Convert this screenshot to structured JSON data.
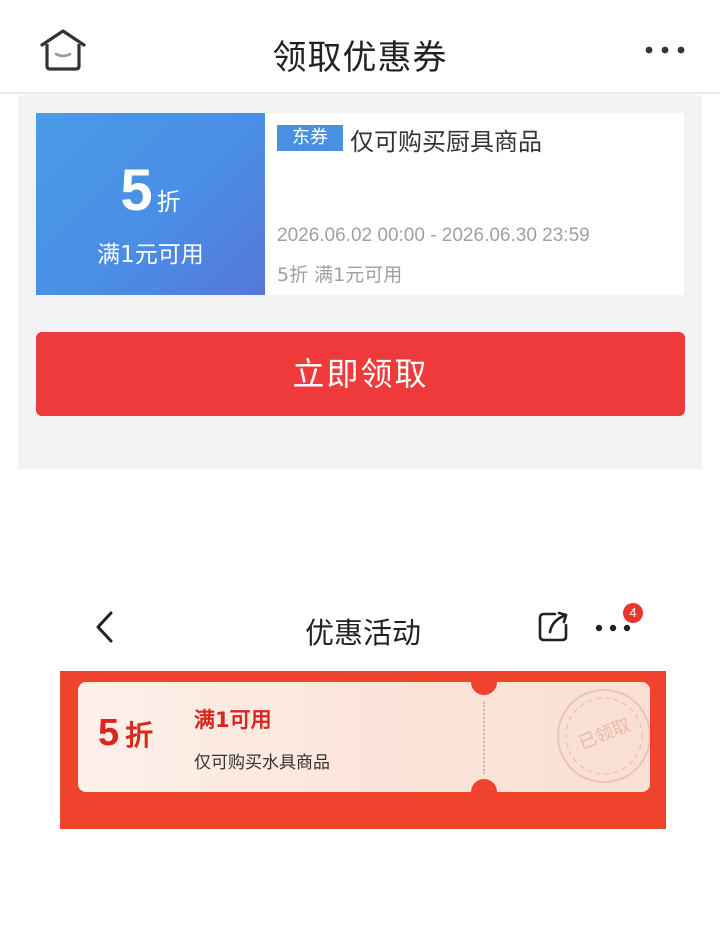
{
  "top": {
    "header": {
      "title": "领取优惠券"
    },
    "coupon": {
      "discount_value": "5",
      "discount_unit": "折",
      "condition": "满1元可用",
      "tag": "东券",
      "title": "仅可购买厨具商品",
      "validity": "2026.06.02 00:00 - 2026.06.30 23:59",
      "description": "5折 满1元可用",
      "colors": {
        "gradient_start": "#4a9be6",
        "gradient_end": "#5577dd",
        "tag_bg": "#4a90e2"
      }
    },
    "claim_button": {
      "label": "立即领取",
      "color": "#ee3a3a"
    }
  },
  "second": {
    "nav": {
      "title": "优惠活动",
      "badge_count": "4"
    },
    "ticket": {
      "discount_value": "5",
      "discount_unit": "折",
      "condition": "满1可用",
      "description": "仅可购买水具商品",
      "stamp": "已领取",
      "colors": {
        "band": "#f0432e",
        "accent": "#d8281e"
      }
    }
  },
  "icons": [
    "home-icon",
    "more-icon",
    "back-icon",
    "share-icon"
  ]
}
